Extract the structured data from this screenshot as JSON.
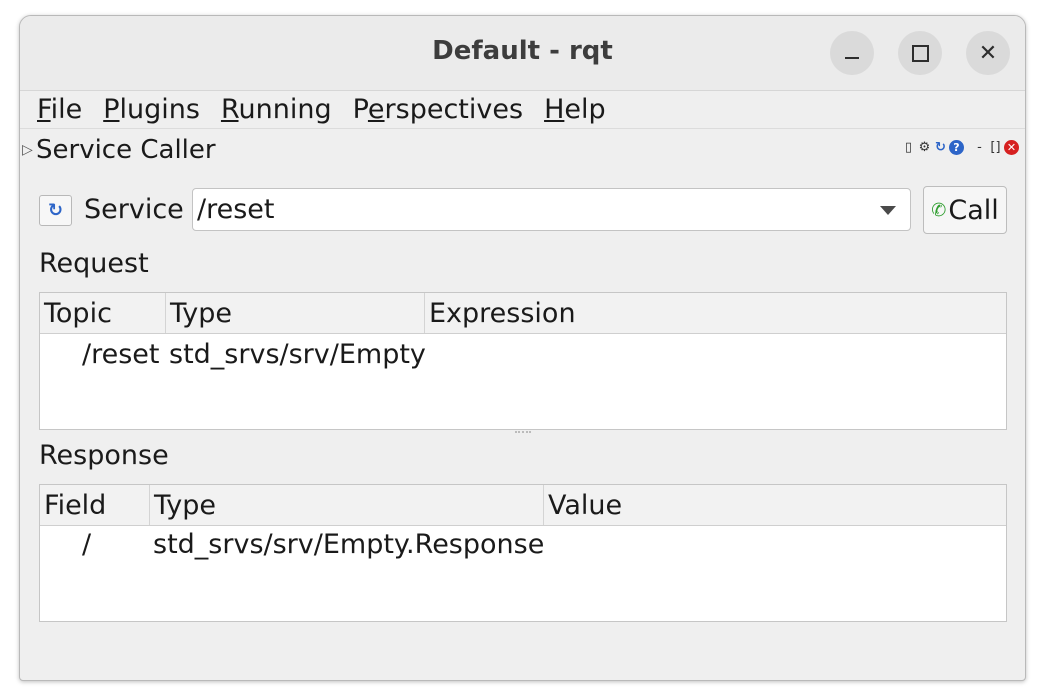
{
  "window": {
    "title": "Default - rqt",
    "controls": [
      "minimize",
      "maximize",
      "close"
    ]
  },
  "menu": [
    {
      "first": "F",
      "rest": "ile"
    },
    {
      "first": "P",
      "rest": "lugins"
    },
    {
      "first": "R",
      "rest": "unning"
    },
    {
      "pre": "P",
      "first": "e",
      "rest": "rspectives"
    },
    {
      "first": "H",
      "rest": "elp"
    }
  ],
  "plugin": {
    "title": "Service Caller",
    "dock_icons": [
      "document-icon",
      "gear-icon",
      "refresh-icon",
      "help-icon",
      "minimize-icon",
      "float-icon",
      "close-icon"
    ]
  },
  "service": {
    "label": "Service",
    "selected": "/reset",
    "call_label": "Call"
  },
  "request": {
    "label": "Request",
    "columns": [
      "Topic",
      "Type",
      "Expression"
    ],
    "rows": [
      {
        "topic": "/reset",
        "type": "std_srvs/srv/Empty",
        "expression": ""
      }
    ]
  },
  "response": {
    "label": "Response",
    "columns": [
      "Field",
      "Type",
      "Value"
    ],
    "rows": [
      {
        "field": "/",
        "type": "std_srvs/srv/Empty.Response",
        "value": ""
      }
    ]
  }
}
